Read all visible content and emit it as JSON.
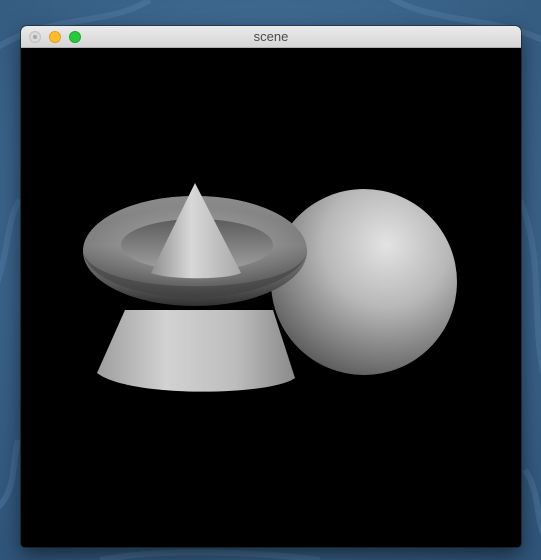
{
  "window": {
    "title": "scene",
    "buttons": {
      "close": "close-window-button",
      "minimize": "minimize-window-button",
      "zoom": "zoom-window-button"
    },
    "colors": {
      "close": "#d9d9d9",
      "minimize": "#ffbd2e",
      "zoom": "#28c940",
      "titlebar": "#e3e3e3",
      "desktop": "#3c6690"
    }
  },
  "scene": {
    "background": "#000000",
    "objects": [
      "torus",
      "small-cone",
      "truncated-cone",
      "sphere"
    ]
  }
}
